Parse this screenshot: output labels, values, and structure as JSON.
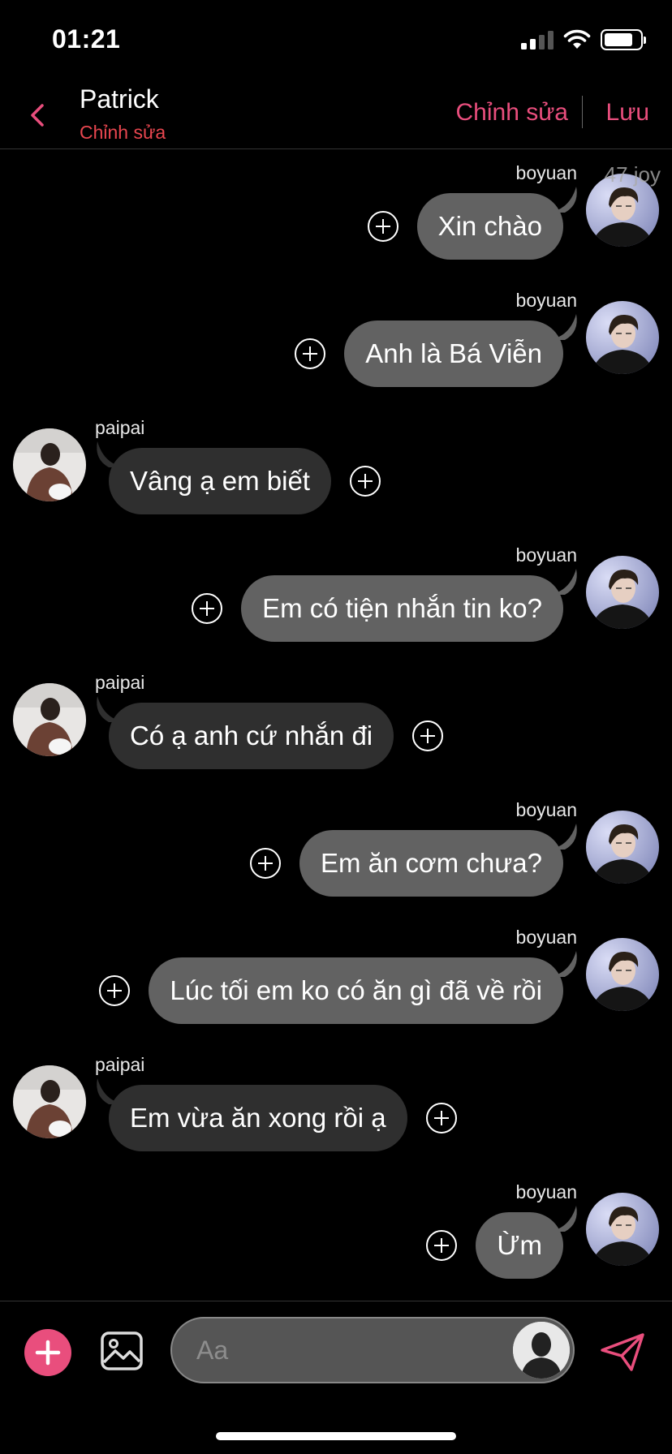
{
  "status_bar": {
    "time": "01:21"
  },
  "header": {
    "back_icon": "chevron-left-icon",
    "name": "Patrick",
    "subtitle": "Chỉnh sửa",
    "edit_label": "Chỉnh sửa",
    "save_label": "Lưu",
    "accent_color": "#e94e7d"
  },
  "watermark": "47 joy",
  "messages": [
    {
      "side": "right",
      "sender": "boyuan",
      "text": "Xin chào"
    },
    {
      "side": "right",
      "sender": "boyuan",
      "text": "Anh là Bá Viễn"
    },
    {
      "side": "left",
      "sender": "paipai",
      "text": "Vâng ạ em biết"
    },
    {
      "side": "right",
      "sender": "boyuan",
      "text": "Em có tiện nhắn tin ko?"
    },
    {
      "side": "left",
      "sender": "paipai",
      "text": "Có ạ anh cứ nhắn đi"
    },
    {
      "side": "right",
      "sender": "boyuan",
      "text": "Em ăn cơm chưa?"
    },
    {
      "side": "right",
      "sender": "boyuan",
      "text": "Lúc tối em ko có ăn gì đã về rồi"
    },
    {
      "side": "left",
      "sender": "paipai",
      "text": "Em vừa ăn xong rồi ạ"
    },
    {
      "side": "right",
      "sender": "boyuan",
      "text": "Ừm"
    }
  ],
  "input_bar": {
    "placeholder": "Aa",
    "add_icon": "plus-circle-icon",
    "image_icon": "image-icon",
    "send_icon": "send-icon"
  }
}
